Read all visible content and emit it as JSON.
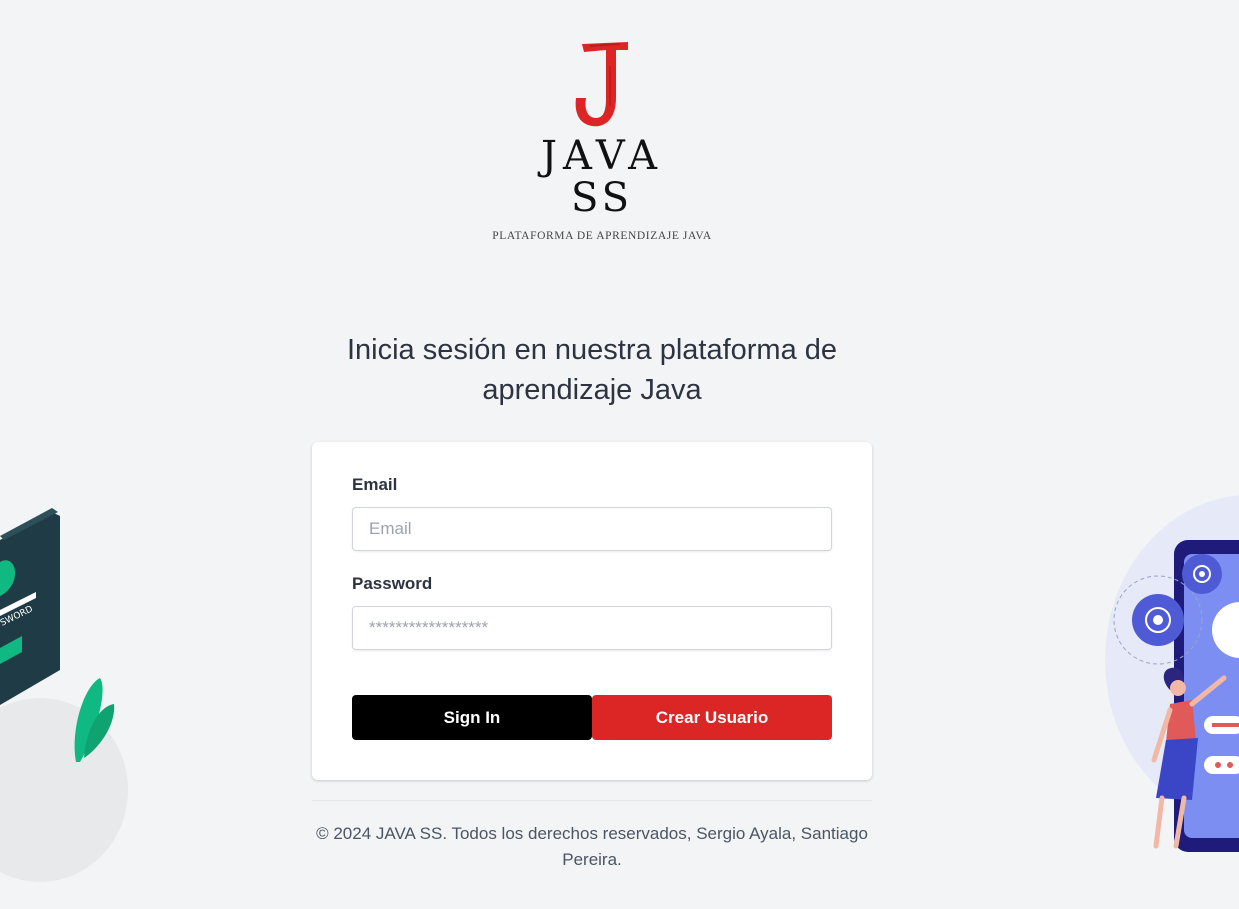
{
  "logo": {
    "wordmark_line1": "JAVA",
    "wordmark_line2": "SS",
    "tagline": "PLATAFORMA DE APRENDIZAJE JAVA",
    "letter": "J",
    "accent_color": "#dc2626"
  },
  "heading": "Inicia sesión en nuestra plataforma de aprendizaje Java",
  "form": {
    "email_label": "Email",
    "email_placeholder": "Email",
    "password_label": "Password",
    "password_placeholder": "******************",
    "signin_label": "Sign In",
    "create_label": "Crear Usuario"
  },
  "footer": "© 2024 JAVA SS. Todos los derechos reservados, Sergio Ayala, Santiago Pereira.",
  "illustrations": {
    "left_badge_text": "SWORD",
    "left_icon": "password-card-illustration",
    "right_icon": "phone-gears-person-illustration"
  },
  "colors": {
    "background": "#f3f4f6",
    "signin_button": "#000000",
    "create_button": "#dc2626"
  }
}
